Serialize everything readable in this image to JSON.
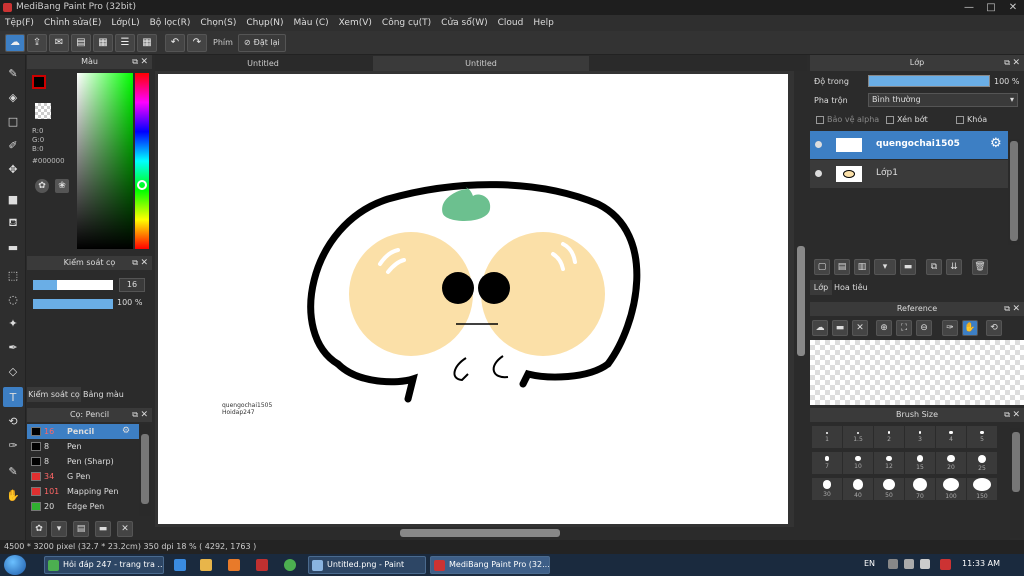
{
  "window": {
    "title": "MediBang Paint Pro (32bit)",
    "min": "—",
    "max": "□",
    "close": "✕"
  },
  "menu": [
    "Tệp(F)",
    "Chỉnh sửa(E)",
    "Lớp(L)",
    "Bộ lọc(R)",
    "Chọn(S)",
    "Chụp(N)",
    "Màu (C)",
    "Xem(V)",
    "Công cụ(T)",
    "Cửa sổ(W)",
    "Cloud",
    "Help"
  ],
  "toolbar": {
    "phim_label": "Phím",
    "reset_label": "Đặt lại"
  },
  "tabs": [
    "Untitled",
    "Untitled"
  ],
  "color_panel": {
    "title": "Màu",
    "r": "R:0",
    "g": "G:0",
    "b": "B:0",
    "hex": "#000000"
  },
  "brush_control": {
    "title": "Kiểm soát cọ",
    "size": "16",
    "opacity": "100 %",
    "size_fraction": 0.3,
    "opacity_fraction": 1.0
  },
  "lower_tabs": {
    "a": "Kiểm soát cọ",
    "b": "Bảng màu"
  },
  "brush_list": {
    "title": "Cọ: Pencil",
    "items": [
      {
        "num": "16",
        "name": "Pencil",
        "color": "#000000",
        "selected": true
      },
      {
        "num": "8",
        "name": "Pen",
        "color": "#000000"
      },
      {
        "num": "8",
        "name": "Pen (Sharp)",
        "color": "#000000"
      },
      {
        "num": "34",
        "name": "G Pen",
        "color": "#e03030"
      },
      {
        "num": "101",
        "name": "Mapping Pen",
        "color": "#e03030"
      },
      {
        "num": "20",
        "name": "Edge Pen",
        "color": "#30b030"
      }
    ]
  },
  "canvas_text": {
    "line1": "quengochai1505",
    "line2": "Hoidap247"
  },
  "layer_panel": {
    "title": "Lớp",
    "opacity_label": "Độ trong",
    "opacity_value": "100 %",
    "blend_label": "Pha trộn",
    "blend_value": "Bình thường",
    "protect_alpha": "Bảo vệ alpha",
    "clipping": "Xén bớt",
    "lock": "Khóa",
    "layers": [
      {
        "name": "quengochai1505",
        "selected": true
      },
      {
        "name": "Lớp1"
      }
    ],
    "tab_layer": "Lớp",
    "tab_navigator": "Hoa tiêu"
  },
  "reference_panel": {
    "title": "Reference"
  },
  "brush_size_panel": {
    "title": "Brush Size",
    "sizes": [
      "1",
      "1.5",
      "2",
      "3",
      "4",
      "5",
      "7",
      "10",
      "12",
      "15",
      "20",
      "25",
      "30",
      "40",
      "50",
      "70",
      "100",
      "150"
    ]
  },
  "status": {
    "text": "4500 * 3200 pixel  (32.7 * 23.2cm)  350 dpi  18 %  ( 4292, 1763 )"
  },
  "taskbar": {
    "items": [
      "Hỏi đáp 247 - trang tra ...",
      "Untitled.png - Paint",
      "MediBang Paint Pro (32..."
    ],
    "lang": "EN",
    "time": "11:33 AM"
  }
}
